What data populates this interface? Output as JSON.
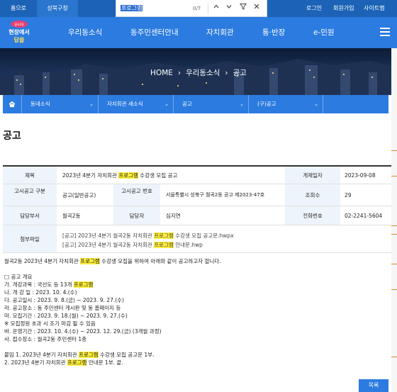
{
  "topbar": {
    "home_label": "홈으로",
    "office_label": "성북구청",
    "login": "로그인",
    "signup": "회원가입",
    "sitemap": "사이트맵"
  },
  "find": {
    "query": "프로그램",
    "count": "0/7"
  },
  "logo": {
    "line1": "현장에서 답을 찾다"
  },
  "nav": {
    "items": [
      "우리동소식",
      "동주민센터안내",
      "자치회관",
      "통·반장",
      "e-민원"
    ]
  },
  "hero": {
    "home": "HOME",
    "crumb1": "우리동소식",
    "crumb2": "공고",
    "sep": "›"
  },
  "subnav": {
    "cells": [
      "동네소식",
      "자치회관 새소식",
      "공고",
      "(구)공고"
    ]
  },
  "page_title": "공고",
  "table": {
    "title_label": "제목",
    "title_pre": "2023년 4분기 자치회관 ",
    "title_hl": "프로그램",
    "title_post": " 수강생 모집 공고",
    "date_label": "게재일자",
    "date_value": "2023-09-08",
    "type_label": "고시공고 구분",
    "type_value": "공고(일반공고)",
    "number_label": "고시공고 번호",
    "number_value": "서울특별시 성북구 월곡2동 공고 제2023-47호",
    "views_label": "조회수",
    "views_value": "29",
    "dept_label": "담당부서",
    "dept_value": "월곡2동",
    "manager_label": "담당자",
    "manager_value": "심지연",
    "phone_label": "전화번호",
    "phone_value": "02-2241-5604",
    "attach_label": "첨부파일",
    "attach1_pre": "[공고] 2023년 4분기 월곡2동 자치회관 ",
    "attach1_post": " 수강생 모집 공고문.hwpx",
    "attach2_pre": "[공고] 2023년 4분기 월곡2동 자치회관 ",
    "attach2_post": " 안내문.hwp"
  },
  "body": {
    "intro_pre": "월곡2동 2023년 4분기 자치회관 ",
    "intro_post": " 수강생 모집을 위하여 아래와 같이 공고하고자 합니다.",
    "heading": "□ 공고 개요",
    "l1": "가. 개강과목 : 국선도 등 13개 ",
    "l2": "나. 개 강 일 : 2023. 10. 4.(수)",
    "l3": "다. 공고일시 : 2023. 9. 8.(금) ~ 2023. 9. 27.(수)",
    "l4": "라. 공고장소 : 동 주민센터 게시판 및 동 홈페이지 등",
    "l5": "마. 모집기간 : 2023. 9. 18.(월) ~ 2023. 9. 27.(수)",
    "l6": "※ 모집정원 초과 시 조기 마감 될 수 있음",
    "l7": "바. 운영기간 : 2023. 10. 4.(수) ~ 2023. 12. 29.(금) (3개월 과정)",
    "l8": "사. 접수장소 : 월곡2동 주민센터 1층",
    "a1_pre": "붙임 1. 2023년 4분기 자치회관 ",
    "a1_post": " 수강생 모집 공고문 1부.",
    "a2_pre": "2. 2023년 4분기 자치회관 ",
    "a2_post": " 안내문 1부. 끝."
  },
  "list_button": "목록",
  "colors": {
    "primary_blue": "#2b7be0",
    "dark_blue": "#1c63b7",
    "highlight": "#ffef3a"
  }
}
